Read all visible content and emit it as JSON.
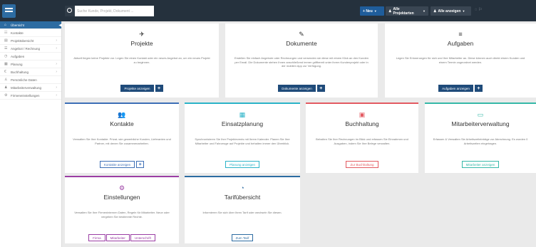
{
  "topbar": {
    "search_placeholder": "Suche Kunde, Projekt, Dokument ...",
    "new_label": "Neu",
    "projects_label": "Alle Projektarten",
    "show_label": "Alle anzeigen",
    "icons_text": "◌ ⚐"
  },
  "sidebar": {
    "items": [
      {
        "label": "Übersicht",
        "icon": "⌂"
      },
      {
        "label": "Kontakte",
        "icon": "☷"
      },
      {
        "label": "Projektübersicht",
        "icon": "▤"
      },
      {
        "label": "Angebot / Rechnung",
        "icon": "☰"
      },
      {
        "label": "Aufgaben",
        "icon": "◷"
      },
      {
        "label": "Planung",
        "icon": "▦"
      },
      {
        "label": "Buchhaltung",
        "icon": "€"
      },
      {
        "label": "Persönliche Daten",
        "icon": "♙"
      },
      {
        "label": "Mitarbeiterverwaltung",
        "icon": "♟"
      },
      {
        "label": "Firmeneinstellungen",
        "icon": "⚙"
      }
    ]
  },
  "cards": {
    "projekte": {
      "icon": "✈",
      "title": "Projekte",
      "text": "Aktuell liegen keine Projekte vor. Legen Sie einen Kontakt oder ein neues Angebot an, um ein neues Projekt zu beginnen.",
      "button": "Projekte anzeigen",
      "plus": "+"
    },
    "dokumente": {
      "icon": "✎",
      "title": "Dokumente",
      "text": "Erstellen Sie einfach Angebote oder Rechnungen und versenden sie diese mit einem Klick an den Kunden per Email. Die Dokumente stehen Ihnen anschließend immer griffbereit unter ihrem Kundenprojekt oder in der mobilen App zur Verfügung.",
      "button": "Dokumente anzeigen",
      "plus": "+"
    },
    "aufgaben": {
      "icon": "≡",
      "title": "Aufgaben",
      "text": "Legen Sie Erinnerungen für sich und Ihre Mitarbeiter an. Diese können auch direkt einem Kunden und einem Termin zugeordnet werden.",
      "button": "Aufgaben anzeigen",
      "plus": "+"
    },
    "kontakte": {
      "icon": "👥",
      "title": "Kontakte",
      "text": "Verwalten Sie Ihre Kontakte. Privat- wie gewerbliche Kunden, Lieferanten und Partner, mit denen Sie zusammenarbeiten.",
      "button": "Kontakte anzeigen",
      "plus": "+"
    },
    "einsatzplanung": {
      "icon": "▦",
      "title": "Einsatzplanung",
      "text": "Synchronisieren Sie Ihre Projektevents mit Ihrem Kalender. Planen Sie Ihre Mitarbeiter und Fahrzeuge auf Projekte und behalten immer den Überblick.",
      "button": "Planung anzeigen"
    },
    "buchhaltung": {
      "icon": "▣",
      "title": "Buchhaltung",
      "text": "Behalten Sie Ihre Rechnungen im Blick und erfassen Sie Einnahmen und Ausgaben, indem Sie Ihre Belege verwalten.",
      "button": "Zur Buchhaltung"
    },
    "mitarbeiterverwaltung": {
      "icon": "▭",
      "title": "Mitarbeiterverwaltung",
      "text": "Erfassen & Verwalten Sie Arbeitszeiteinträge zur Abrechnung. Es wurden 0 Arbeitszeiten eingetragen.",
      "button": "Mitarbeiter anzeigen"
    },
    "einstellungen": {
      "icon": "⚙",
      "title": "Einstellungen",
      "text": "Verwalten Sie Ihre Firmeninternen Daten, Regeln für Mitarbeiter. Neue oder vergeben Sie bestimmte Rechte.",
      "buttons": [
        "Firma",
        "Mitarbeiter",
        "Unterschrift"
      ]
    },
    "tarif": {
      "icon": "◔",
      "title": "Tarifübersicht",
      "text": "Informieren Sie sich über Ihren Tarif oder wechseln Sie diesen.",
      "button": "Zum Tarif"
    }
  },
  "colors": {
    "topbar": "#25313d",
    "accent": "#2d6ca2",
    "kontakte": "#3d6fb6",
    "einsatzplanung": "#2bb3c8",
    "buchhaltung": "#e35a61",
    "mitarbeiter": "#35b8a8",
    "einstellungen": "#9b3ea4",
    "tarif": "#2d6ca2"
  }
}
